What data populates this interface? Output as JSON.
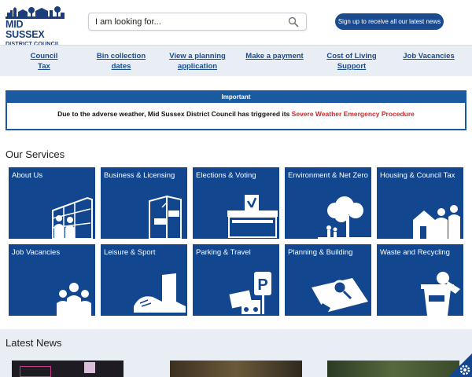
{
  "logo": {
    "line1": "MID SUSSEX",
    "line2": "DISTRICT COUNCIL"
  },
  "search": {
    "placeholder": "I am looking for..."
  },
  "signup": {
    "label": "Sign up to receive all our latest news"
  },
  "quicklinks": [
    {
      "label": "Council Tax"
    },
    {
      "label": "Bin collection dates"
    },
    {
      "label": "View a planning application"
    },
    {
      "label": "Make a payment"
    },
    {
      "label": "Cost of Living Support"
    },
    {
      "label": "Job Vacancies"
    }
  ],
  "alert": {
    "heading": "Important",
    "text": "Due to the adverse weather, Mid Sussex District Council has triggered its ",
    "link": "Severe Weather Emergency Procedure"
  },
  "services": {
    "title": "Our Services",
    "tiles": [
      {
        "label": "About Us",
        "icon": "building-people-icon"
      },
      {
        "label": "Business & Licensing",
        "icon": "shop-door-icon"
      },
      {
        "label": "Elections & Voting",
        "icon": "ballot-box-icon"
      },
      {
        "label": "Environment & Net Zero",
        "icon": "tree-family-icon"
      },
      {
        "label": "Housing & Council Tax",
        "icon": "house-family-icon"
      },
      {
        "label": "Job Vacancies",
        "icon": "group-people-icon"
      },
      {
        "label": "Leisure & Sport",
        "icon": "boot-trainer-icon"
      },
      {
        "label": "Parking & Travel",
        "icon": "parking-sign-icon"
      },
      {
        "label": "Planning & Building",
        "icon": "plan-magnifier-icon"
      },
      {
        "label": "Waste and Recycling",
        "icon": "recycling-bin-icon"
      }
    ]
  },
  "news": {
    "title": "Latest News"
  },
  "colors": {
    "brand": "#12468f",
    "nav_bg": "#e9eef5",
    "alert_red": "#d4262b",
    "button": "#1a4b8f"
  }
}
